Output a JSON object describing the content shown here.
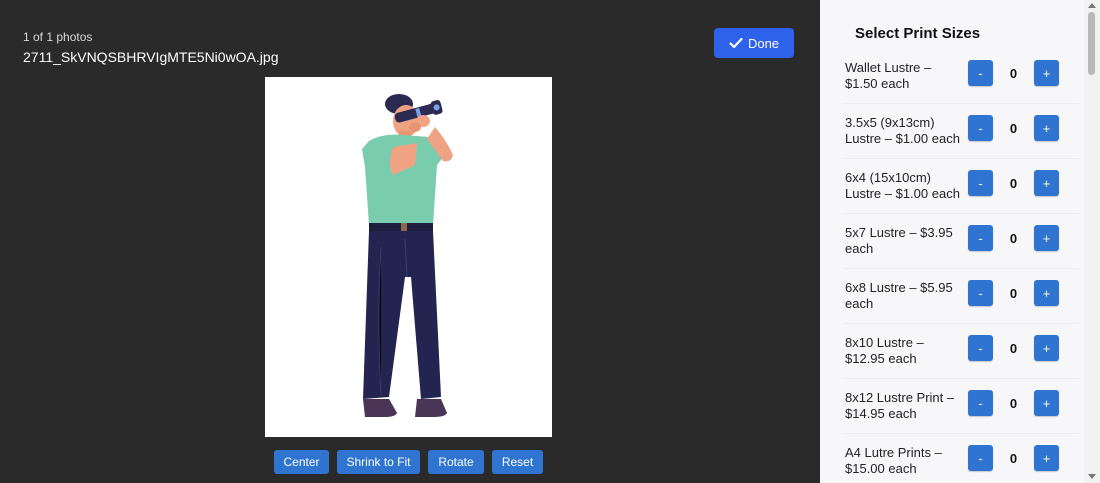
{
  "photo": {
    "count_label": "1 of 1 photos",
    "filename": "2711_SkVNQSBHRVIgMTE5Ni0wOA.jpg"
  },
  "done_button": {
    "label": "Done",
    "icon": "checkmark-icon"
  },
  "tools": [
    "Center",
    "Shrink to Fit",
    "Rotate",
    "Reset"
  ],
  "panel": {
    "title": "Select Print Sizes",
    "sizes": [
      {
        "label": "Wallet Lustre – $1.50 each",
        "qty": "0"
      },
      {
        "label": "3.5x5 (9x13cm) Lustre – $1.00 each",
        "qty": "0"
      },
      {
        "label": "6x4 (15x10cm) Lustre – $1.00 each",
        "qty": "0"
      },
      {
        "label": "5x7 Lustre – $3.95 each",
        "qty": "0"
      },
      {
        "label": "6x8 Lustre – $5.95 each",
        "qty": "0"
      },
      {
        "label": "8x10 Lustre – $12.95 each",
        "qty": "0"
      },
      {
        "label": "8x12 Lustre Print – $14.95 each",
        "qty": "0"
      },
      {
        "label": "A4 Lutre Prints – $15.00 each",
        "qty": "0"
      }
    ],
    "minus_label": "-",
    "plus_label": "+"
  },
  "colors": {
    "background": "#2a2a2b",
    "accent": "#2f62ea",
    "button": "#2f74d0",
    "panel": "#f7f7f9"
  }
}
